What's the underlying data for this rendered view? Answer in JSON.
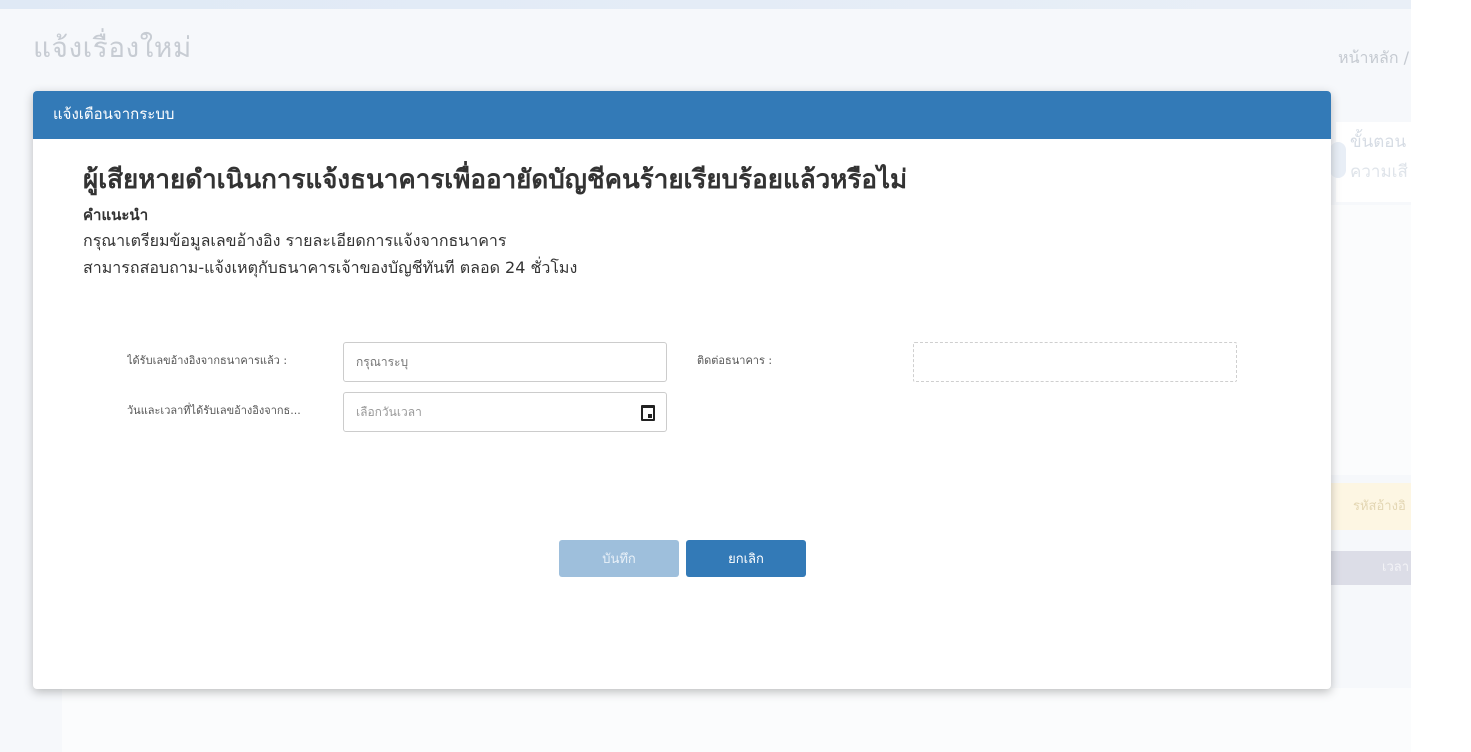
{
  "page": {
    "title": "แจ้งเรื่องใหม่",
    "breadcrumb": "หน้าหลัก /",
    "background": {
      "step_line1": "ขั้นตอน",
      "step_line2": "ความเสี",
      "ref_label": "รหัสอ้างอิ",
      "time_label": "เวลา"
    }
  },
  "modal": {
    "header": "แจ้งเตือนจากระบบ",
    "question": "ผู้เสียหายดำเนินการแจ้งธนาคารเพื่ออายัดบัญชีคนร้ายเรียบร้อยแล้วหรือไม่",
    "advice_label": "คำแนะนำ",
    "advice_line1": "กรุณาเตรียมข้อมูลเลขอ้างอิง รายละเอียดการแจ้งจากธนาคาร",
    "advice_line2": "สามารถสอบถาม-แจ้งเหตุกับธนาคารเจ้าของบัญชีทันที ตลอด 24 ชั่วโมง",
    "form": {
      "ref_label": "ได้รับเลขอ้างอิงจากธนาคารแล้ว :",
      "ref_placeholder": "กรุณาระบุ",
      "bank_label": "ติดต่อธนาคาร :",
      "bank_value": "",
      "datetime_label": "วันและเวลาที่ได้รับเลขอ้างอิงจากธ...",
      "datetime_placeholder": "เลือกวันเวลา"
    },
    "buttons": {
      "save": "บันทึก",
      "cancel": "ยกเลิก"
    }
  },
  "colors": {
    "header": "#337ab7",
    "primary_button": "#337ab7",
    "disabled_button": "#9ebfdc"
  }
}
